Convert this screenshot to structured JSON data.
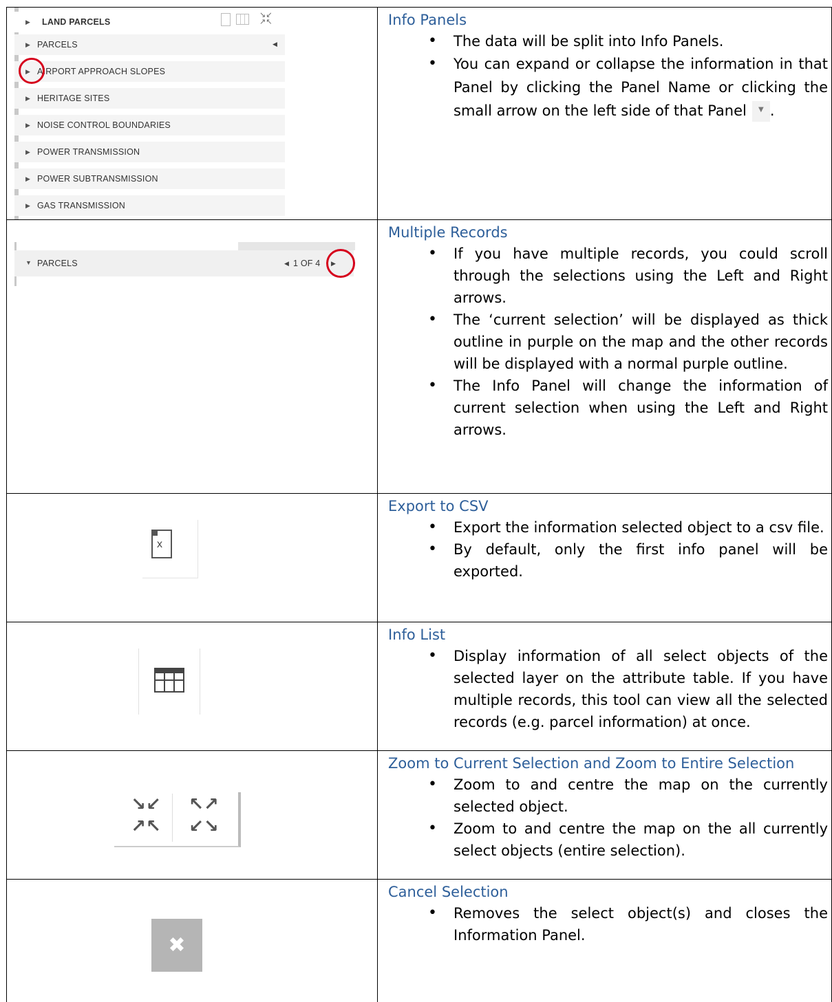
{
  "sections": [
    {
      "heading": "Info Panels",
      "bullets": [
        "The data will be split into Info Panels.",
        "You can expand or collapse the information in that Panel by clicking the Panel Name or clicking the small arrow on the left side of that Panel"
      ],
      "bullet_tail": "."
    },
    {
      "heading": "Multiple Records",
      "bullets": [
        "If you have multiple records, you could scroll through the selections using the Left and Right arrows.",
        "The ‘current selection’ will be displayed as thick outline in purple on the map and the other records will be displayed with a normal purple outline.",
        "The Info Panel will change the information of current selection when using the Left and Right arrows."
      ]
    },
    {
      "heading": "Export to CSV",
      "bullets": [
        "Export the information selected object to a csv file.",
        "By default, only the first info panel will be exported."
      ]
    },
    {
      "heading": "Info List",
      "bullets": [
        "Display information of all select objects of the selected layer on the attribute table. If you have multiple records, this tool can view all the selected records (e.g. parcel information) at once."
      ]
    },
    {
      "heading": "Zoom to Current Selection and Zoom to Entire Selection",
      "bullets": [
        "Zoom to and centre the map on the currently selected object.",
        "Zoom to and centre the map on the all currently select objects (entire selection)."
      ]
    },
    {
      "heading": "Cancel Selection",
      "bullets": [
        "Removes the select object(s) and closes the Information Panel."
      ]
    }
  ],
  "panel_list": {
    "header": "LAND PARCELS",
    "items": [
      "PARCELS",
      "AIRPORT APPROACH SLOPES",
      "HERITAGE SITES",
      "NOISE CONTROL BOUNDARIES",
      "POWER TRANSMISSION",
      "POWER SUBTRANSMISSION",
      "GAS TRANSMISSION"
    ]
  },
  "records_panel": {
    "label": "PARCELS",
    "pager": "1 OF 4"
  },
  "colors": {
    "heading": "#2e5f9a",
    "highlight_circle": "#d6001c"
  }
}
